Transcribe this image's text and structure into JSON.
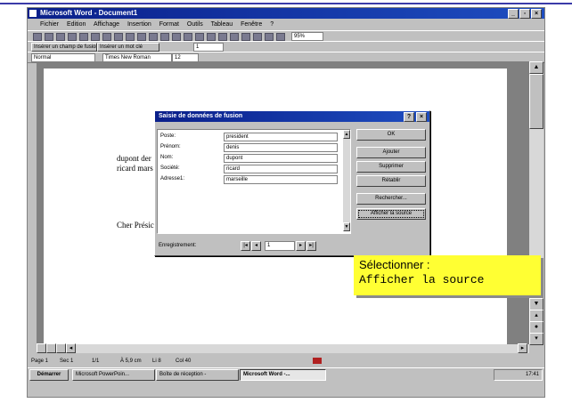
{
  "window": {
    "title": "Microsoft Word - Document1"
  },
  "menu": [
    "Fichier",
    "Edition",
    "Affichage",
    "Insertion",
    "Format",
    "Outils",
    "Tableau",
    "Fenêtre",
    "?"
  ],
  "toolbar": {
    "zoom": "95%"
  },
  "mailmerge_bar": {
    "insert_merge_field": "Insérer un champ de fusion",
    "insert_word_field": "Insérer un mot clé",
    "record": "1"
  },
  "format_bar": {
    "style": "Normal",
    "font": "Times New Roman",
    "size": "12"
  },
  "document": {
    "line1": "dupont der",
    "line2": "ricard mars",
    "line3": "Cher Présic"
  },
  "dialog": {
    "title": "Saisie de données de fusion",
    "fields": [
      {
        "label": "Poste:",
        "value": "president"
      },
      {
        "label": "Prénom:",
        "value": "denis"
      },
      {
        "label": "Nom:",
        "value": "dupont"
      },
      {
        "label": "Société:",
        "value": "ricard"
      },
      {
        "label": "Adresse1:",
        "value": "marseille"
      }
    ],
    "buttons": {
      "ok": "OK",
      "ajouter": "Ajouter",
      "supprimer": "Supprimer",
      "retablir": "Rétablir",
      "rechercher": "Rechercher...",
      "afficher": "Afficher la source"
    },
    "record_label": "Enregistrement:",
    "record_value": "1"
  },
  "statusbar": {
    "page": "Page 1",
    "sec": "Sec 1",
    "pages": "1/1",
    "pos": "À 5,9 cm",
    "line": "Li 8",
    "col": "Col 40"
  },
  "taskbar": {
    "start": "Démarrer",
    "tasks": [
      "Microsoft PowerPoin...",
      "Boîte de réception -",
      "Microsoft Word -..."
    ],
    "clock": "17:41"
  },
  "callout": {
    "line1": "Sélectionner :",
    "line2": "Afficher la source"
  }
}
